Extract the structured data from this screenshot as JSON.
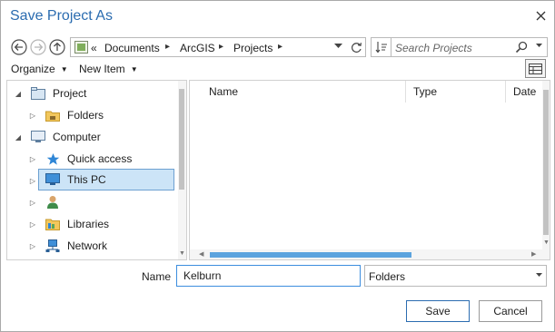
{
  "window": {
    "title": "Save Project As",
    "accent_color": "#2b6cb0"
  },
  "nav": {
    "back_icon": "arrow-left-icon",
    "forward_icon": "arrow-right-icon",
    "up_icon": "arrow-up-icon"
  },
  "address": {
    "overflow": "«",
    "crumbs": [
      "Documents",
      "ArcGIS",
      "Projects"
    ]
  },
  "search": {
    "placeholder": "Search Projects"
  },
  "toolbar": {
    "organize_label": "Organize",
    "new_item_label": "New Item"
  },
  "tree": {
    "items": [
      {
        "label": "Project",
        "icon": "project-icon",
        "expander": "expanded"
      },
      {
        "label": "Folders",
        "icon": "folder-icon",
        "expander": "collapsed"
      },
      {
        "label": "Computer",
        "icon": "computer-icon",
        "expander": "expanded"
      },
      {
        "label": "Quick access",
        "icon": "star-icon",
        "expander": "collapsed"
      },
      {
        "label": "This PC",
        "icon": "monitor-icon",
        "expander": "collapsed",
        "selected": true
      },
      {
        "label": "",
        "icon": "user-icon",
        "expander": "collapsed"
      },
      {
        "label": "Libraries",
        "icon": "libraries-icon",
        "expander": "collapsed"
      },
      {
        "label": "Network",
        "icon": "network-icon",
        "expander": "collapsed"
      }
    ]
  },
  "list": {
    "columns": [
      "Name",
      "Type",
      "Date"
    ]
  },
  "footer": {
    "name_label": "Name",
    "name_value": "Kelburn",
    "type_value": "Folders",
    "save_label": "Save",
    "cancel_label": "Cancel"
  }
}
